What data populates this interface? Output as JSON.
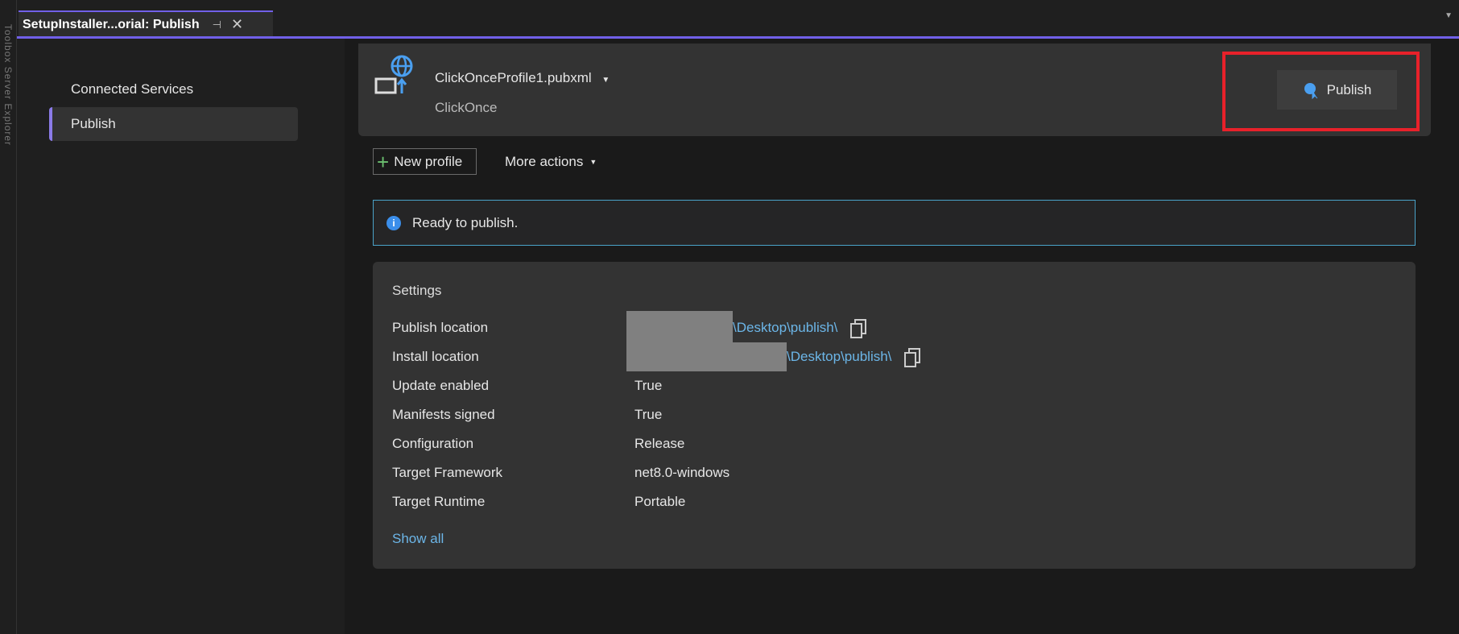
{
  "left_strip": {
    "text": "Toolbox  Server Explorer"
  },
  "tab": {
    "title": "SetupInstaller...orial: Publish",
    "pin_icon": "pin",
    "close_icon": "close"
  },
  "sidebar": {
    "items": [
      {
        "label": "Connected Services"
      },
      {
        "label": "Publish",
        "selected": true
      }
    ]
  },
  "profile": {
    "name": "ClickOnceProfile1.pubxml",
    "type": "ClickOnce",
    "publish_button": "Publish"
  },
  "actions": {
    "new_profile": "New profile",
    "more_actions": "More actions"
  },
  "info": {
    "message": "Ready to publish."
  },
  "settings": {
    "title": "Settings",
    "rows": [
      {
        "label": "Publish location",
        "value": "\\Desktop\\publish\\"
      },
      {
        "label": "Install location",
        "value": "\\Desktop\\publish\\"
      },
      {
        "label": "Update enabled",
        "value": "True"
      },
      {
        "label": "Manifests signed",
        "value": "True"
      },
      {
        "label": "Configuration",
        "value": "Release"
      },
      {
        "label": "Target Framework",
        "value": "net8.0-windows"
      },
      {
        "label": "Target Runtime",
        "value": "Portable"
      }
    ],
    "show_all": "Show all"
  },
  "colors": {
    "accent": "#7160e8",
    "highlight": "#e8212a",
    "link": "#6cb6e8",
    "info_border": "#4aa3c9"
  }
}
